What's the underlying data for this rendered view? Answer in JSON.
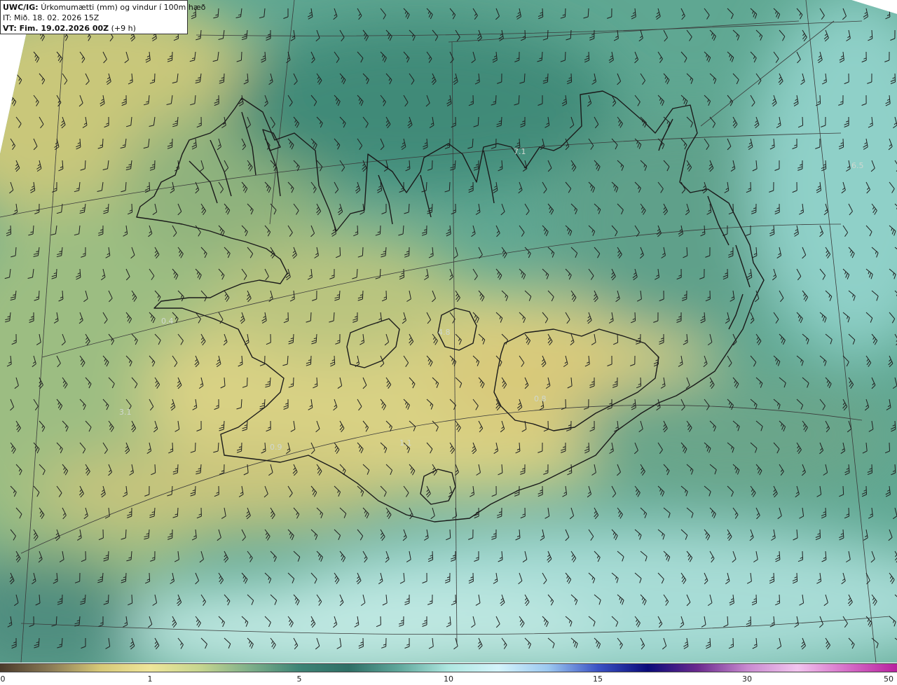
{
  "header": {
    "product": "UWC/IG:",
    "title": "Úrkomumætti (mm) og vindur í 100m hæð",
    "issue_time": "IT: Mið. 18. 02. 2026 15Z",
    "valid_label": "VT: Fim. 19.02.2026 00Z",
    "valid_lead": "(+9 h)"
  },
  "colorbar": {
    "ticks": [
      "0",
      "1",
      "5",
      "10",
      "15",
      "30",
      "50"
    ],
    "colors": [
      "#4a3a2a",
      "#8a7a55",
      "#d6c877",
      "#efe69a",
      "#c7d68f",
      "#7fb08a",
      "#3e8476",
      "#2f6f66",
      "#5fa79b",
      "#aee7e0",
      "#d4f4fb",
      "#9cc8f0",
      "#3b52c4",
      "#0b0b7a",
      "#6b2a8e",
      "#c98ad0",
      "#f2c4ee",
      "#d56fc8",
      "#b8219f"
    ]
  },
  "map": {
    "point_values": [
      "7.1",
      "3.1",
      "0.8",
      "4.8",
      "6.5",
      "1.1",
      "0.4",
      "0.9"
    ],
    "colors": {
      "land_outline": "#1a1a1a",
      "graticule": "#3a3a3a",
      "wind_barb": "#1f1f1f",
      "low_precip": "#e8dc8e",
      "mid_precip": "#4f9e88",
      "high_precip": "#b5e6e0",
      "outside": "#ffffff"
    }
  }
}
